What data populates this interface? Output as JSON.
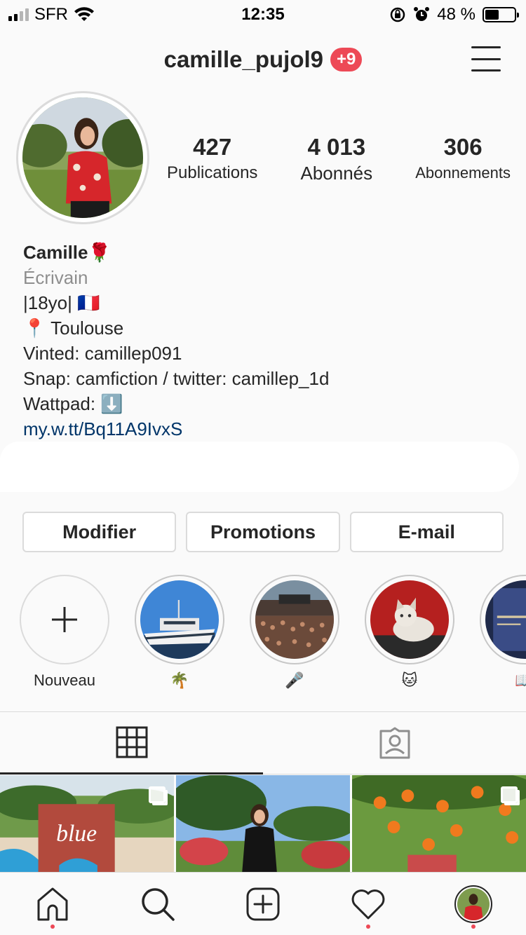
{
  "status_bar": {
    "carrier": "SFR",
    "time": "12:35",
    "battery_percent": "48 %",
    "battery_level": 0.48
  },
  "header": {
    "username": "camille_pujol9",
    "notification_badge": "+9"
  },
  "stats": [
    {
      "value": "427",
      "label": "Publications"
    },
    {
      "value": "4 013",
      "label": "Abonnés"
    },
    {
      "value": "306",
      "label": "Abonnements"
    }
  ],
  "bio": {
    "name": "Camille",
    "name_emoji": "🌹",
    "category": "Écrivain",
    "line_age": "|18yo|",
    "line_age_emoji": "🇫🇷",
    "line_location_emoji": "📍",
    "line_location": "Toulouse",
    "line_vinted": "Vinted: camillep091",
    "line_snap": "Snap: camfiction / twitter: camillep_1d",
    "line_wattpad": "Wattpad:",
    "line_wattpad_emoji": "⬇️",
    "link": "my.w.tt/Bq11A9IvxS"
  },
  "buttons": {
    "edit": "Modifier",
    "promotions": "Promotions",
    "email": "E-mail"
  },
  "highlights": [
    {
      "label": "Nouveau",
      "icon": "plus-icon"
    },
    {
      "label": "🌴",
      "icon": "boat-photo"
    },
    {
      "label": "🎤",
      "icon": "concert-photo"
    },
    {
      "label": "🐱",
      "icon": "cat-photo"
    },
    {
      "label": "📖",
      "icon": "book-photo"
    }
  ],
  "tabs": {
    "grid": "grid-icon",
    "tagged": "tagged-icon"
  },
  "nav": [
    "home-icon",
    "search-icon",
    "add-post-icon",
    "heart-icon",
    "profile-avatar"
  ],
  "colors": {
    "accent_red": "#ed4956",
    "link_blue": "#003569",
    "border": "#dbdbdb",
    "muted_text": "#8e8e8e"
  }
}
